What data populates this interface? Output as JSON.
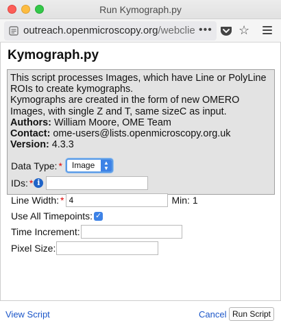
{
  "window": {
    "title": "Run Kymograph.py"
  },
  "browser": {
    "url_host": "outreach.openmicroscopy.org",
    "url_path": "/webclie",
    "page_actions_icon": "more-dots-icon",
    "pocket_icon": "pocket-icon",
    "bookmark_icon": "star-icon",
    "menu_icon": "hamburger-menu-icon"
  },
  "script": {
    "title": "Kymograph.py",
    "description_line1": "This script processes Images, which have Line or PolyLine ROIs to create kymographs.",
    "description_line2": "Kymographs are created in the form of new OMERO Images, with single Z and T, same sizeC as input.",
    "authors_label": "Authors:",
    "authors_value": " William Moore, OME Team",
    "contact_label": "Contact:",
    "contact_value": " ome-users@lists.openmicroscopy.org.uk",
    "version_label": "Version:",
    "version_value": " 4.3.3"
  },
  "form": {
    "data_type": {
      "label": "Data Type:",
      "required_mark": "*",
      "selected": "Image"
    },
    "ids": {
      "label": "IDs:",
      "required_mark": "*",
      "info_glyph": "i",
      "value": ""
    },
    "line_width": {
      "label": "Line Width:",
      "required_mark": "*",
      "value": "4",
      "min_text": "Min: 1"
    },
    "use_all_timepoints": {
      "label": "Use All Timepoints:",
      "checked": true,
      "check_glyph": "✓"
    },
    "time_increment": {
      "label": "Time Increment:",
      "value": ""
    },
    "pixel_size": {
      "label": "Pixel Size:",
      "value": ""
    }
  },
  "footer": {
    "view_script": "View Script",
    "cancel": "Cancel",
    "run_script": "Run Script"
  },
  "colors": {
    "link": "#1a55c8",
    "description_bg": "#e3e3e3",
    "required": "#dd0000",
    "accent": "#3d82e6"
  }
}
